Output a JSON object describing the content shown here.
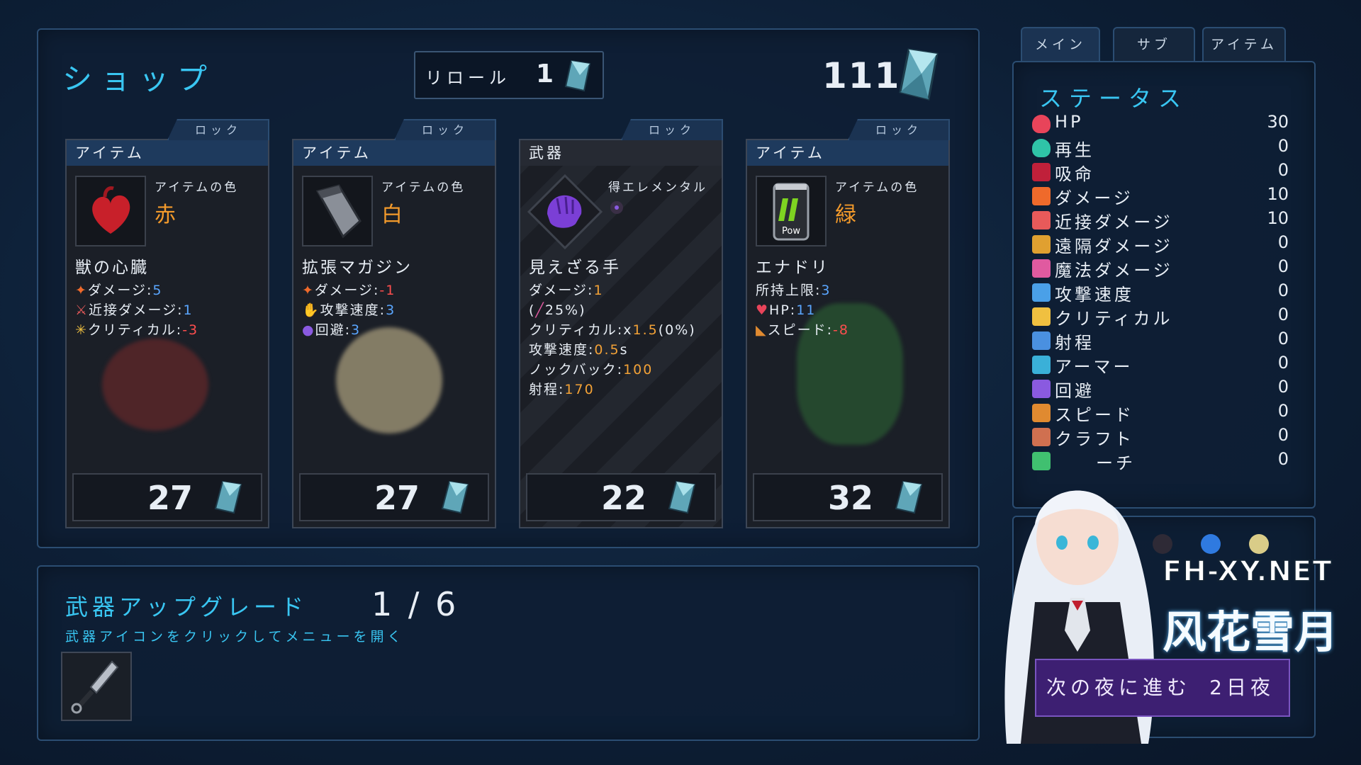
{
  "shop": {
    "title": "ショップ",
    "reroll_label": "リロール",
    "reroll_cost": "1",
    "currency": "111"
  },
  "cards": [
    {
      "category": "アイテム",
      "lock": "ロック",
      "color_label": "アイテムの色",
      "color": "赤",
      "name": "獣の心臓",
      "stats": [
        {
          "icon": "damage-icon",
          "label": "ダメージ:",
          "value": "5",
          "tone": "pos"
        },
        {
          "icon": "melee-damage-icon",
          "label": "近接ダメージ:",
          "value": "1",
          "tone": "pos"
        },
        {
          "icon": "critical-icon",
          "label": "クリティカル:",
          "value": "-3",
          "tone": "neg"
        }
      ],
      "price": "27"
    },
    {
      "category": "アイテム",
      "lock": "ロック",
      "color_label": "アイテムの色",
      "color": "白",
      "name": "拡張マガジン",
      "stats": [
        {
          "icon": "damage-icon",
          "label": "ダメージ:",
          "value": "-1",
          "tone": "neg"
        },
        {
          "icon": "attack-speed-icon",
          "label": "攻撃速度:",
          "value": "3",
          "tone": "pos"
        },
        {
          "icon": "evasion-icon",
          "label": "回避:",
          "value": "3",
          "tone": "pos"
        }
      ],
      "price": "27"
    },
    {
      "category": "武器",
      "lock": "ロック",
      "elemental_label": "得エレメンタル",
      "name": "見えざる手",
      "stats": [
        {
          "label": "ダメージ:",
          "value": "1",
          "tone": "org"
        },
        {
          "label": "(",
          "value": "25%)",
          "tone": "plain"
        },
        {
          "label": "クリティカル:x",
          "value": "1.5",
          "suffix": "(0%)",
          "tone": "org"
        },
        {
          "label": "攻撃速度:",
          "value": "0.5",
          "suffix": "s",
          "tone": "org"
        },
        {
          "label": "ノックバック:",
          "value": "100",
          "tone": "org"
        },
        {
          "label": "射程:",
          "value": "170",
          "tone": "org"
        }
      ],
      "price": "22"
    },
    {
      "category": "アイテム",
      "lock": "ロック",
      "color_label": "アイテムの色",
      "color": "緑",
      "name": "エナドリ",
      "can_text": "Pow",
      "stats": [
        {
          "label": "所持上限:",
          "value": "3",
          "tone": "pos"
        },
        {
          "icon": "hp-icon",
          "label": "HP:",
          "value": "11",
          "tone": "pos"
        },
        {
          "icon": "speed-icon",
          "label": "スピード:",
          "value": "-8",
          "tone": "neg"
        }
      ],
      "price": "32"
    }
  ],
  "tabs": [
    "メイン",
    "サブ",
    "アイテム"
  ],
  "status": {
    "title": "ステータス",
    "rows": [
      {
        "label": "HP",
        "value": "30",
        "icon": "heart-icon",
        "color": "#e8445a"
      },
      {
        "label": "再生",
        "value": "0",
        "icon": "regen-heart-icon",
        "color": "#2fc4a8"
      },
      {
        "label": "吸命",
        "value": "0",
        "icon": "lifesteal-icon",
        "color": "#c0203a"
      },
      {
        "label": "ダメージ",
        "value": "10",
        "icon": "damage-icon",
        "color": "#ef6a2b"
      },
      {
        "label": "近接ダメージ",
        "value": "10",
        "icon": "melee-icon",
        "color": "#e85a5a"
      },
      {
        "label": "遠隔ダメージ",
        "value": "0",
        "icon": "bow-icon",
        "color": "#e0a030"
      },
      {
        "label": "魔法ダメージ",
        "value": "0",
        "icon": "wand-icon",
        "color": "#e05aa0"
      },
      {
        "label": "攻撃速度",
        "value": "0",
        "icon": "attack-speed-icon",
        "color": "#4aa0e8"
      },
      {
        "label": "クリティカル",
        "value": "0",
        "icon": "critical-icon",
        "color": "#f0c040"
      },
      {
        "label": "射程",
        "value": "0",
        "icon": "range-icon",
        "color": "#4a90e0"
      },
      {
        "label": "アーマー",
        "value": "0",
        "icon": "shield-icon",
        "color": "#3ab0d8"
      },
      {
        "label": "回避",
        "value": "0",
        "icon": "evasion-icon",
        "color": "#8a5ae0"
      },
      {
        "label": "スピード",
        "value": "0",
        "icon": "boot-icon",
        "color": "#e08a30"
      },
      {
        "label": "クラフト",
        "value": "0",
        "icon": "hammer-icon",
        "color": "#d07050"
      },
      {
        "label": "",
        "value": "0",
        "icon": "search-icon",
        "color": "#40c070"
      }
    ],
    "partial_label": "ーチ"
  },
  "upgrade": {
    "title": "武器アップグレード",
    "count": "1 / 6",
    "hint": "武器アイコンをクリックしてメニューを開く"
  },
  "next_night": {
    "label": "次の夜に進む",
    "day": "2日夜"
  },
  "watermark": {
    "site": "FH-XY.NET",
    "name": "风花雪月"
  }
}
